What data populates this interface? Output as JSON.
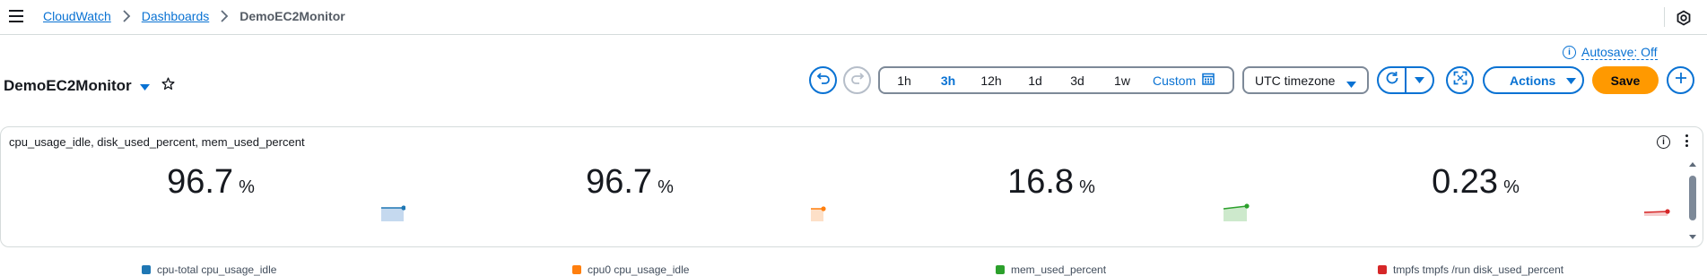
{
  "breadcrumb": {
    "items": [
      "CloudWatch",
      "Dashboards"
    ],
    "current": "DemoEC2Monitor"
  },
  "header": {
    "autosave_label": "Autosave: Off",
    "info_glyph": "i",
    "dashboard_title": "DemoEC2Monitor"
  },
  "toolbar": {
    "time_ranges": [
      "1h",
      "3h",
      "12h",
      "1d",
      "3d",
      "1w"
    ],
    "active_time_range": "3h",
    "custom_label": "Custom",
    "timezone_label": "UTC timezone",
    "actions_label": "Actions",
    "save_label": "Save"
  },
  "widget": {
    "title": "cpu_usage_idle, disk_used_percent, mem_used_percent",
    "info_glyph": "i",
    "metrics": [
      {
        "value": "96.7",
        "unit": "%",
        "legend": "cpu-total cpu_usage_idle",
        "color": "#1f77b4",
        "fill": "#c5d9ef"
      },
      {
        "value": "96.7",
        "unit": "%",
        "legend": "cpu0 cpu_usage_idle",
        "color": "#ff7f0e",
        "fill": "#fde0c8"
      },
      {
        "value": "16.8",
        "unit": "%",
        "legend": "mem_used_percent",
        "color": "#2ca02c",
        "fill": "#cde9cc"
      },
      {
        "value": "0.23",
        "unit": "%",
        "legend": "tmpfs tmpfs /run disk_used_percent",
        "color": "#d62728",
        "fill": "#f6cdcd"
      }
    ]
  },
  "colors": {
    "link_blue": "#0972d3",
    "save_orange": "#ff9900",
    "border_gray": "#d5dbdb"
  },
  "icons": {
    "menu": "hamburger-icon",
    "chevron": "chevron-right-icon",
    "undo": "undo-icon",
    "redo": "redo-icon",
    "calendar": "calendar-icon",
    "refresh": "refresh-icon",
    "fullscreen": "fullscreen-icon",
    "add": "add-icon",
    "star": "star-icon",
    "settings": "settings-icon"
  }
}
